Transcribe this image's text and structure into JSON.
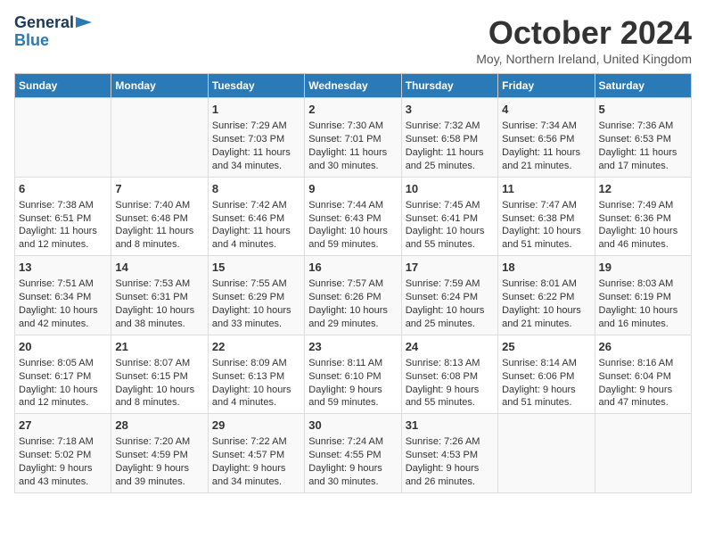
{
  "header": {
    "logo_line1": "General",
    "logo_line2": "Blue",
    "month_title": "October 2024",
    "subtitle": "Moy, Northern Ireland, United Kingdom"
  },
  "columns": [
    "Sunday",
    "Monday",
    "Tuesday",
    "Wednesday",
    "Thursday",
    "Friday",
    "Saturday"
  ],
  "weeks": [
    [
      {
        "day": "",
        "info": ""
      },
      {
        "day": "",
        "info": ""
      },
      {
        "day": "1",
        "info": "Sunrise: 7:29 AM\nSunset: 7:03 PM\nDaylight: 11 hours and 34 minutes."
      },
      {
        "day": "2",
        "info": "Sunrise: 7:30 AM\nSunset: 7:01 PM\nDaylight: 11 hours and 30 minutes."
      },
      {
        "day": "3",
        "info": "Sunrise: 7:32 AM\nSunset: 6:58 PM\nDaylight: 11 hours and 25 minutes."
      },
      {
        "day": "4",
        "info": "Sunrise: 7:34 AM\nSunset: 6:56 PM\nDaylight: 11 hours and 21 minutes."
      },
      {
        "day": "5",
        "info": "Sunrise: 7:36 AM\nSunset: 6:53 PM\nDaylight: 11 hours and 17 minutes."
      }
    ],
    [
      {
        "day": "6",
        "info": "Sunrise: 7:38 AM\nSunset: 6:51 PM\nDaylight: 11 hours and 12 minutes."
      },
      {
        "day": "7",
        "info": "Sunrise: 7:40 AM\nSunset: 6:48 PM\nDaylight: 11 hours and 8 minutes."
      },
      {
        "day": "8",
        "info": "Sunrise: 7:42 AM\nSunset: 6:46 PM\nDaylight: 11 hours and 4 minutes."
      },
      {
        "day": "9",
        "info": "Sunrise: 7:44 AM\nSunset: 6:43 PM\nDaylight: 10 hours and 59 minutes."
      },
      {
        "day": "10",
        "info": "Sunrise: 7:45 AM\nSunset: 6:41 PM\nDaylight: 10 hours and 55 minutes."
      },
      {
        "day": "11",
        "info": "Sunrise: 7:47 AM\nSunset: 6:38 PM\nDaylight: 10 hours and 51 minutes."
      },
      {
        "day": "12",
        "info": "Sunrise: 7:49 AM\nSunset: 6:36 PM\nDaylight: 10 hours and 46 minutes."
      }
    ],
    [
      {
        "day": "13",
        "info": "Sunrise: 7:51 AM\nSunset: 6:34 PM\nDaylight: 10 hours and 42 minutes."
      },
      {
        "day": "14",
        "info": "Sunrise: 7:53 AM\nSunset: 6:31 PM\nDaylight: 10 hours and 38 minutes."
      },
      {
        "day": "15",
        "info": "Sunrise: 7:55 AM\nSunset: 6:29 PM\nDaylight: 10 hours and 33 minutes."
      },
      {
        "day": "16",
        "info": "Sunrise: 7:57 AM\nSunset: 6:26 PM\nDaylight: 10 hours and 29 minutes."
      },
      {
        "day": "17",
        "info": "Sunrise: 7:59 AM\nSunset: 6:24 PM\nDaylight: 10 hours and 25 minutes."
      },
      {
        "day": "18",
        "info": "Sunrise: 8:01 AM\nSunset: 6:22 PM\nDaylight: 10 hours and 21 minutes."
      },
      {
        "day": "19",
        "info": "Sunrise: 8:03 AM\nSunset: 6:19 PM\nDaylight: 10 hours and 16 minutes."
      }
    ],
    [
      {
        "day": "20",
        "info": "Sunrise: 8:05 AM\nSunset: 6:17 PM\nDaylight: 10 hours and 12 minutes."
      },
      {
        "day": "21",
        "info": "Sunrise: 8:07 AM\nSunset: 6:15 PM\nDaylight: 10 hours and 8 minutes."
      },
      {
        "day": "22",
        "info": "Sunrise: 8:09 AM\nSunset: 6:13 PM\nDaylight: 10 hours and 4 minutes."
      },
      {
        "day": "23",
        "info": "Sunrise: 8:11 AM\nSunset: 6:10 PM\nDaylight: 9 hours and 59 minutes."
      },
      {
        "day": "24",
        "info": "Sunrise: 8:13 AM\nSunset: 6:08 PM\nDaylight: 9 hours and 55 minutes."
      },
      {
        "day": "25",
        "info": "Sunrise: 8:14 AM\nSunset: 6:06 PM\nDaylight: 9 hours and 51 minutes."
      },
      {
        "day": "26",
        "info": "Sunrise: 8:16 AM\nSunset: 6:04 PM\nDaylight: 9 hours and 47 minutes."
      }
    ],
    [
      {
        "day": "27",
        "info": "Sunrise: 7:18 AM\nSunset: 5:02 PM\nDaylight: 9 hours and 43 minutes."
      },
      {
        "day": "28",
        "info": "Sunrise: 7:20 AM\nSunset: 4:59 PM\nDaylight: 9 hours and 39 minutes."
      },
      {
        "day": "29",
        "info": "Sunrise: 7:22 AM\nSunset: 4:57 PM\nDaylight: 9 hours and 34 minutes."
      },
      {
        "day": "30",
        "info": "Sunrise: 7:24 AM\nSunset: 4:55 PM\nDaylight: 9 hours and 30 minutes."
      },
      {
        "day": "31",
        "info": "Sunrise: 7:26 AM\nSunset: 4:53 PM\nDaylight: 9 hours and 26 minutes."
      },
      {
        "day": "",
        "info": ""
      },
      {
        "day": "",
        "info": ""
      }
    ]
  ]
}
